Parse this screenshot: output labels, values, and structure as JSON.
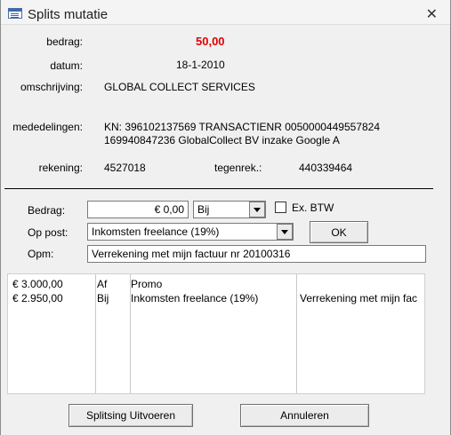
{
  "window": {
    "title": "Splits mutatie"
  },
  "details": {
    "bedrag_label": "bedrag:",
    "bedrag_value": "50,00",
    "datum_label": "datum:",
    "datum_value": "18-1-2010",
    "omschrijving_label": "omschrijving:",
    "omschrijving_value": "GLOBAL COLLECT SERVICES",
    "mededelingen_label": "mededelingen:",
    "mededelingen_line1": "KN: 396102137569 TRANSACTIENR 0050000449557824",
    "mededelingen_line2": "169940847236 GlobalCollect BV inzake Google A",
    "rekening_label": "rekening:",
    "rekening_value": "4527018",
    "tegenrek_label": "tegenrek.:",
    "tegenrek_value": "440339464"
  },
  "form": {
    "bedrag_label": "Bedrag:",
    "bedrag_value": "€ 0,00",
    "type_value": "Bij",
    "ex_btw_label": "Ex. BTW",
    "op_post_label": "Op post:",
    "op_post_value": "Inkomsten freelance (19%)",
    "ok_label": "OK",
    "opm_label": "Opm:",
    "opm_value": "Verrekening met mijn factuur nr 20100316"
  },
  "list": {
    "rows": [
      {
        "amount": "€ 3.000,00",
        "type": "Af",
        "post": "Promo",
        "note": ""
      },
      {
        "amount": "€ 2.950,00",
        "type": "Bij",
        "post": "Inkomsten freelance (19%)",
        "note": "Verrekening met mijn fac"
      }
    ]
  },
  "buttons": {
    "execute_label": "Splitsing Uitvoeren",
    "cancel_label": "Annuleren"
  },
  "colors": {
    "amount_red": "#e00000"
  }
}
